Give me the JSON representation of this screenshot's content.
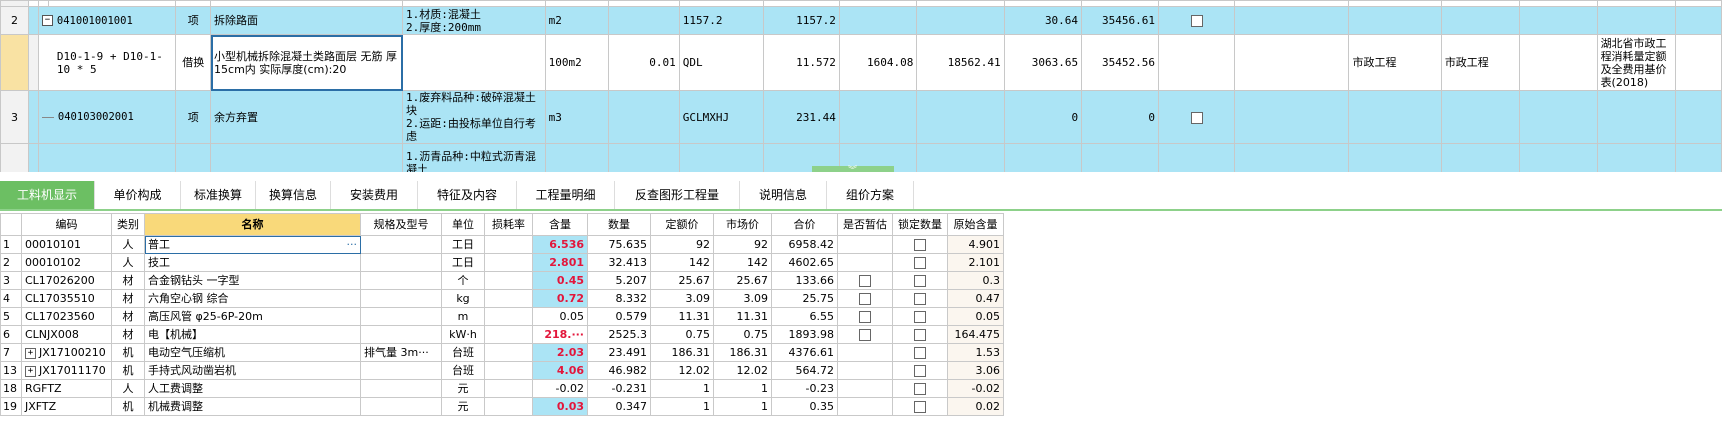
{
  "top_rows": [
    {
      "no": "2",
      "code": "041001001001",
      "type": "项",
      "name": "拆除路面",
      "feature": "1.材质:混凝土\n2.厚度:200mm",
      "unit": "m2",
      "qty": "",
      "expr": "1157.2",
      "qty2": "1157.2",
      "c1": "",
      "c2": "",
      "c3": "30.64",
      "c4": "35456.61",
      "chk": true,
      "spec": "",
      "major": "",
      "lib": ""
    },
    {
      "no": "",
      "code": "D10-1-9 + D10-1-10 * 5",
      "type": "借换",
      "name": "小型机械拆除混凝土类路面层 无筋 厚15cm内  实际厚度(cm):20",
      "feature": "",
      "unit": "100m2",
      "qty": "0.01",
      "expr": "QDL",
      "qty2": "11.572",
      "c1": "1604.08",
      "c2": "18562.41",
      "c3": "3063.65",
      "c4": "35452.56",
      "chk": false,
      "spec": "市政工程",
      "major": "市政工程",
      "lib": "湖北省市政工程消耗量定额及全费用基价表(2018)"
    },
    {
      "no": "3",
      "code": "040103002001",
      "type": "项",
      "name": "余方弃置",
      "feature": "1.废弃料品种:破碎混凝土块\n2.运距:由投标单位自行考虑",
      "unit": "m3",
      "qty": "",
      "expr": "GCLMXHJ",
      "qty2": "231.44",
      "c1": "",
      "c2": "",
      "c3": "0",
      "c4": "0",
      "chk": true,
      "spec": "",
      "major": "",
      "lib": ""
    },
    {
      "no": "",
      "code": "",
      "type": "",
      "name": "",
      "feature": "1.沥青品种:中粒式沥青混凝土",
      "unit": "",
      "qty": "",
      "expr": "",
      "qty2": "",
      "c1": "",
      "c2": "",
      "c3": "",
      "c4": "",
      "chk": false,
      "spec": "",
      "major": "",
      "lib": ""
    }
  ],
  "tabs": [
    "工料机显示",
    "单价构成",
    "标准换算",
    "换算信息",
    "安装费用",
    "特征及内容",
    "工程量明细",
    "反查图形工程量",
    "说明信息",
    "组价方案"
  ],
  "bottom_headers": [
    "",
    "编码",
    "类别",
    "名称",
    "规格及型号",
    "单位",
    "损耗率",
    "含量",
    "数量",
    "定额价",
    "市场价",
    "合价",
    "是否暂估",
    "锁定数量",
    "原始含量"
  ],
  "bottom_rows": [
    {
      "rn": "1",
      "code": "00010101",
      "cat": "人",
      "name": "普工",
      "spec": "",
      "unit": "工日",
      "loss": "",
      "content": "6.536",
      "qty": "75.635",
      "price": "92",
      "market": "92",
      "total": "6958.42",
      "est": false,
      "lock": true,
      "orig": "4.901",
      "red": true,
      "hl": true,
      "expand": false
    },
    {
      "rn": "2",
      "code": "00010102",
      "cat": "人",
      "name": "技工",
      "spec": "",
      "unit": "工日",
      "loss": "",
      "content": "2.801",
      "qty": "32.413",
      "price": "142",
      "market": "142",
      "total": "4602.65",
      "est": false,
      "lock": true,
      "orig": "2.101",
      "red": true,
      "hl": true,
      "expand": false
    },
    {
      "rn": "3",
      "code": "CL17026200",
      "cat": "材",
      "name": "合金钢钻头 一字型",
      "spec": "",
      "unit": "个",
      "loss": "",
      "content": "0.45",
      "qty": "5.207",
      "price": "25.67",
      "market": "25.67",
      "total": "133.66",
      "est": true,
      "lock": true,
      "orig": "0.3",
      "red": true,
      "hl": true,
      "expand": false
    },
    {
      "rn": "4",
      "code": "CL17035510",
      "cat": "材",
      "name": "六角空心钢 综合",
      "spec": "",
      "unit": "kg",
      "loss": "",
      "content": "0.72",
      "qty": "8.332",
      "price": "3.09",
      "market": "3.09",
      "total": "25.75",
      "est": true,
      "lock": true,
      "orig": "0.47",
      "red": true,
      "hl": true,
      "expand": false
    },
    {
      "rn": "5",
      "code": "CL17023560",
      "cat": "材",
      "name": "高压风管 φ25-6P-20m",
      "spec": "",
      "unit": "m",
      "loss": "",
      "content": "0.05",
      "qty": "0.579",
      "price": "11.31",
      "market": "11.31",
      "total": "6.55",
      "est": true,
      "lock": true,
      "orig": "0.05",
      "red": false,
      "hl": false,
      "expand": false
    },
    {
      "rn": "6",
      "code": "CLNJX008",
      "cat": "材",
      "name": "电【机械】",
      "spec": "",
      "unit": "kW·h",
      "loss": "",
      "content": "218.···",
      "qty": "2525.3",
      "price": "0.75",
      "market": "0.75",
      "total": "1893.98",
      "est": true,
      "lock": true,
      "orig": "164.475",
      "red": true,
      "hl": false,
      "expand": false
    },
    {
      "rn": "7",
      "code": "JX17100210",
      "cat": "机",
      "name": "电动空气压缩机",
      "spec": "排气量 3m···",
      "unit": "台班",
      "loss": "",
      "content": "2.03",
      "qty": "23.491",
      "price": "186.31",
      "market": "186.31",
      "total": "4376.61",
      "est": false,
      "lock": true,
      "orig": "1.53",
      "red": true,
      "hl": true,
      "expand": true
    },
    {
      "rn": "13",
      "code": "JX17011170",
      "cat": "机",
      "name": "手持式风动凿岩机",
      "spec": "",
      "unit": "台班",
      "loss": "",
      "content": "4.06",
      "qty": "46.982",
      "price": "12.02",
      "market": "12.02",
      "total": "564.72",
      "est": false,
      "lock": true,
      "orig": "3.06",
      "red": true,
      "hl": true,
      "expand": true
    },
    {
      "rn": "18",
      "code": "RGFTZ",
      "cat": "人",
      "name": "人工费调整",
      "spec": "",
      "unit": "元",
      "loss": "",
      "content": "-0.02",
      "qty": "-0.231",
      "price": "1",
      "market": "1",
      "total": "-0.23",
      "est": false,
      "lock": true,
      "orig": "-0.02",
      "red": false,
      "hl": false,
      "expand": false
    },
    {
      "rn": "19",
      "code": "JXFTZ",
      "cat": "机",
      "name": "机械费调整",
      "spec": "",
      "unit": "元",
      "loss": "",
      "content": "0.03",
      "qty": "0.347",
      "price": "1",
      "market": "1",
      "total": "0.35",
      "est": false,
      "lock": true,
      "orig": "0.02",
      "red": true,
      "hl": true,
      "expand": false
    }
  ]
}
